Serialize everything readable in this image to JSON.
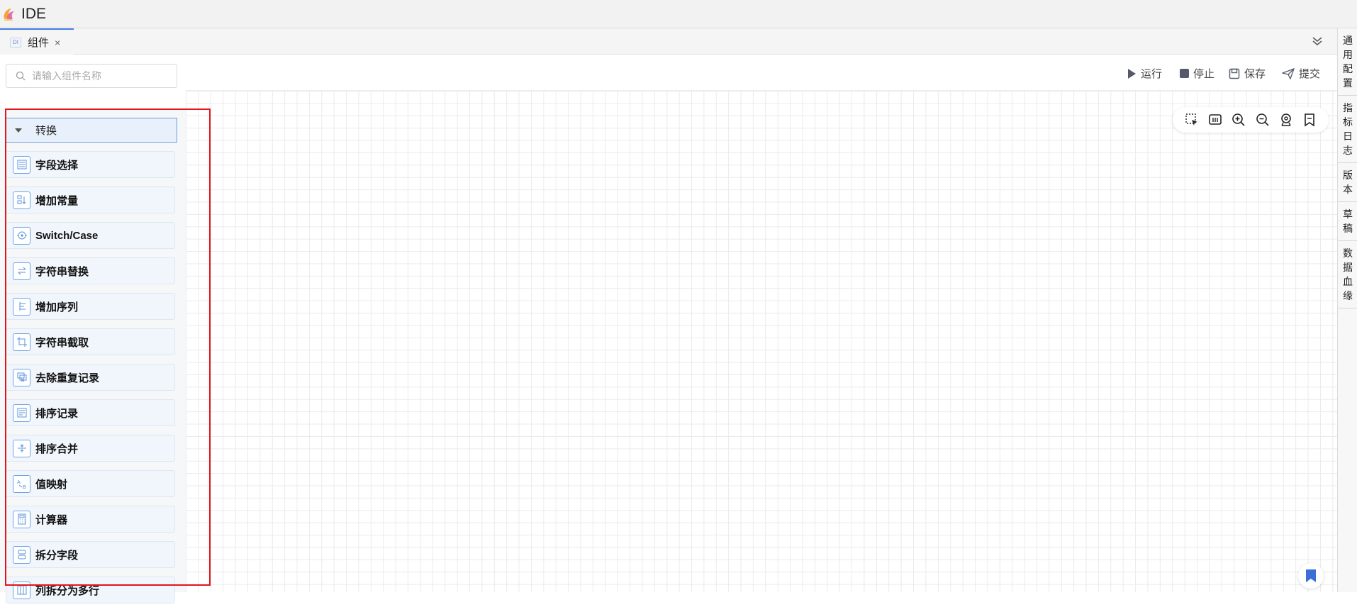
{
  "app": {
    "title": "IDE"
  },
  "tabs": [
    {
      "badge": "DI",
      "label": "组件",
      "close": "×"
    }
  ],
  "search": {
    "placeholder": "请输入组件名称"
  },
  "group": {
    "label": "转换"
  },
  "components": [
    {
      "label": "字段选择",
      "icon": "field-select-icon"
    },
    {
      "label": "增加常量",
      "icon": "add-constant-icon"
    },
    {
      "label": "Switch/Case",
      "icon": "switch-case-icon"
    },
    {
      "label": "字符串替换",
      "icon": "string-replace-icon"
    },
    {
      "label": "增加序列",
      "icon": "add-sequence-icon"
    },
    {
      "label": "字符串截取",
      "icon": "string-cut-icon"
    },
    {
      "label": "去除重复记录",
      "icon": "dedupe-icon"
    },
    {
      "label": "排序记录",
      "icon": "sort-records-icon"
    },
    {
      "label": "排序合并",
      "icon": "sort-merge-icon"
    },
    {
      "label": "值映射",
      "icon": "value-mapping-icon"
    },
    {
      "label": "计算器",
      "icon": "calculator-icon"
    },
    {
      "label": "拆分字段",
      "icon": "split-field-icon"
    },
    {
      "label": "列拆分为多行",
      "icon": "split-rows-icon"
    }
  ],
  "toolbar": {
    "run": "运行",
    "stop": "停止",
    "save": "保存",
    "submit": "提交"
  },
  "right_panel": [
    {
      "label": "通用配置",
      "chars": [
        "通",
        "用",
        "配",
        "置"
      ]
    },
    {
      "label": "指标日志",
      "chars": [
        "指",
        "标",
        "日",
        "志"
      ]
    },
    {
      "label": "版本",
      "chars": [
        "版",
        "本"
      ]
    },
    {
      "label": "草稿",
      "chars": [
        "草",
        "稿"
      ]
    },
    {
      "label": "数据血缘",
      "chars": [
        "数",
        "据",
        "血",
        "缘"
      ]
    }
  ],
  "colors": {
    "accent": "#4a7fe0",
    "highlight": "#e0161e",
    "item_bg": "#f1f6fc",
    "icon_blue": "#5b93dc"
  }
}
